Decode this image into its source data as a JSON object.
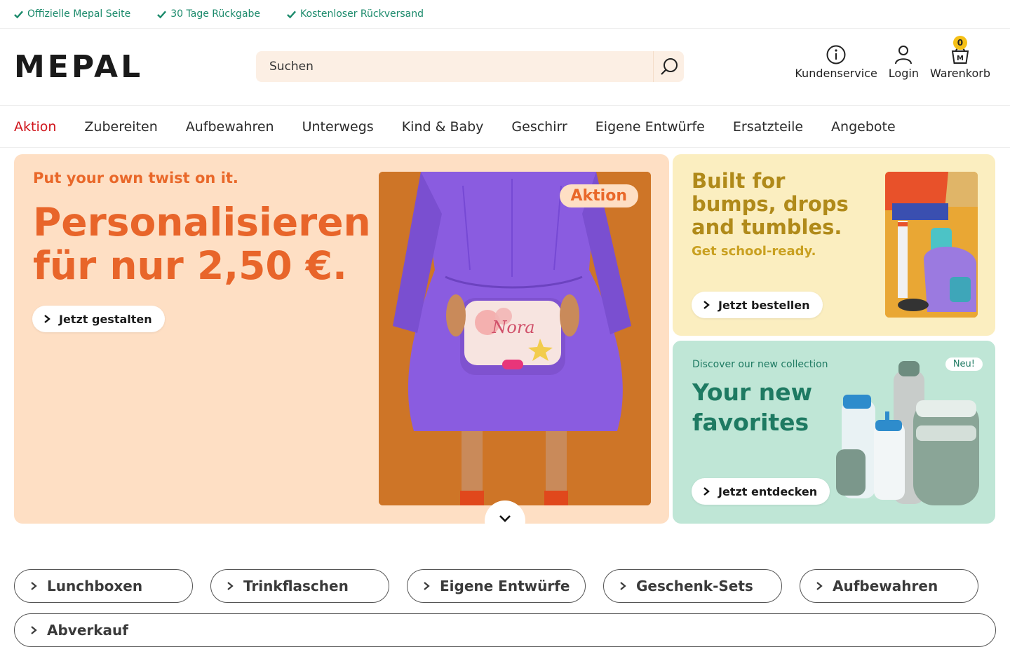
{
  "usp": [
    "Offizielle Mepal Seite",
    "30 Tage Rückgabe",
    "Kostenloser Rückversand"
  ],
  "header": {
    "logo": "MEPAL",
    "search_placeholder": "Suchen",
    "actions": {
      "service": "Kundenservice",
      "login": "Login",
      "cart": "Warenkorb",
      "cart_count": "0"
    }
  },
  "nav": [
    "Aktion",
    "Zubereiten",
    "Aufbewahren",
    "Unterwegs",
    "Kind & Baby",
    "Geschirr",
    "Eigene Entwürfe",
    "Ersatzteile",
    "Angebote"
  ],
  "hero": {
    "tag": "Put your own twist on it.",
    "title": "Personalisieren für nur 2,50 €.",
    "cta": "Jetzt gestalten",
    "badge": "Aktion",
    "lunchbox_name": "Nora"
  },
  "card_yellow": {
    "title": "Built for bumps, drops and tumbles.",
    "subtitle": "Get school-ready.",
    "cta": "Jetzt bestellen"
  },
  "card_green": {
    "tag": "Discover our new collection",
    "title": "Your new favorites",
    "badge": "Neu!",
    "cta": "Jetzt entdecken"
  },
  "categories": [
    "Lunchboxen",
    "Trinkflaschen",
    "Eigene Entwürfe",
    "Geschenk-Sets",
    "Aufbewahren"
  ],
  "category_wide": "Abverkauf",
  "colors": {
    "accent_orange": "#e8652a",
    "usp_green": "#1b8a6b",
    "nav_active": "#d0141b",
    "badge_yellow": "#f5c017"
  }
}
